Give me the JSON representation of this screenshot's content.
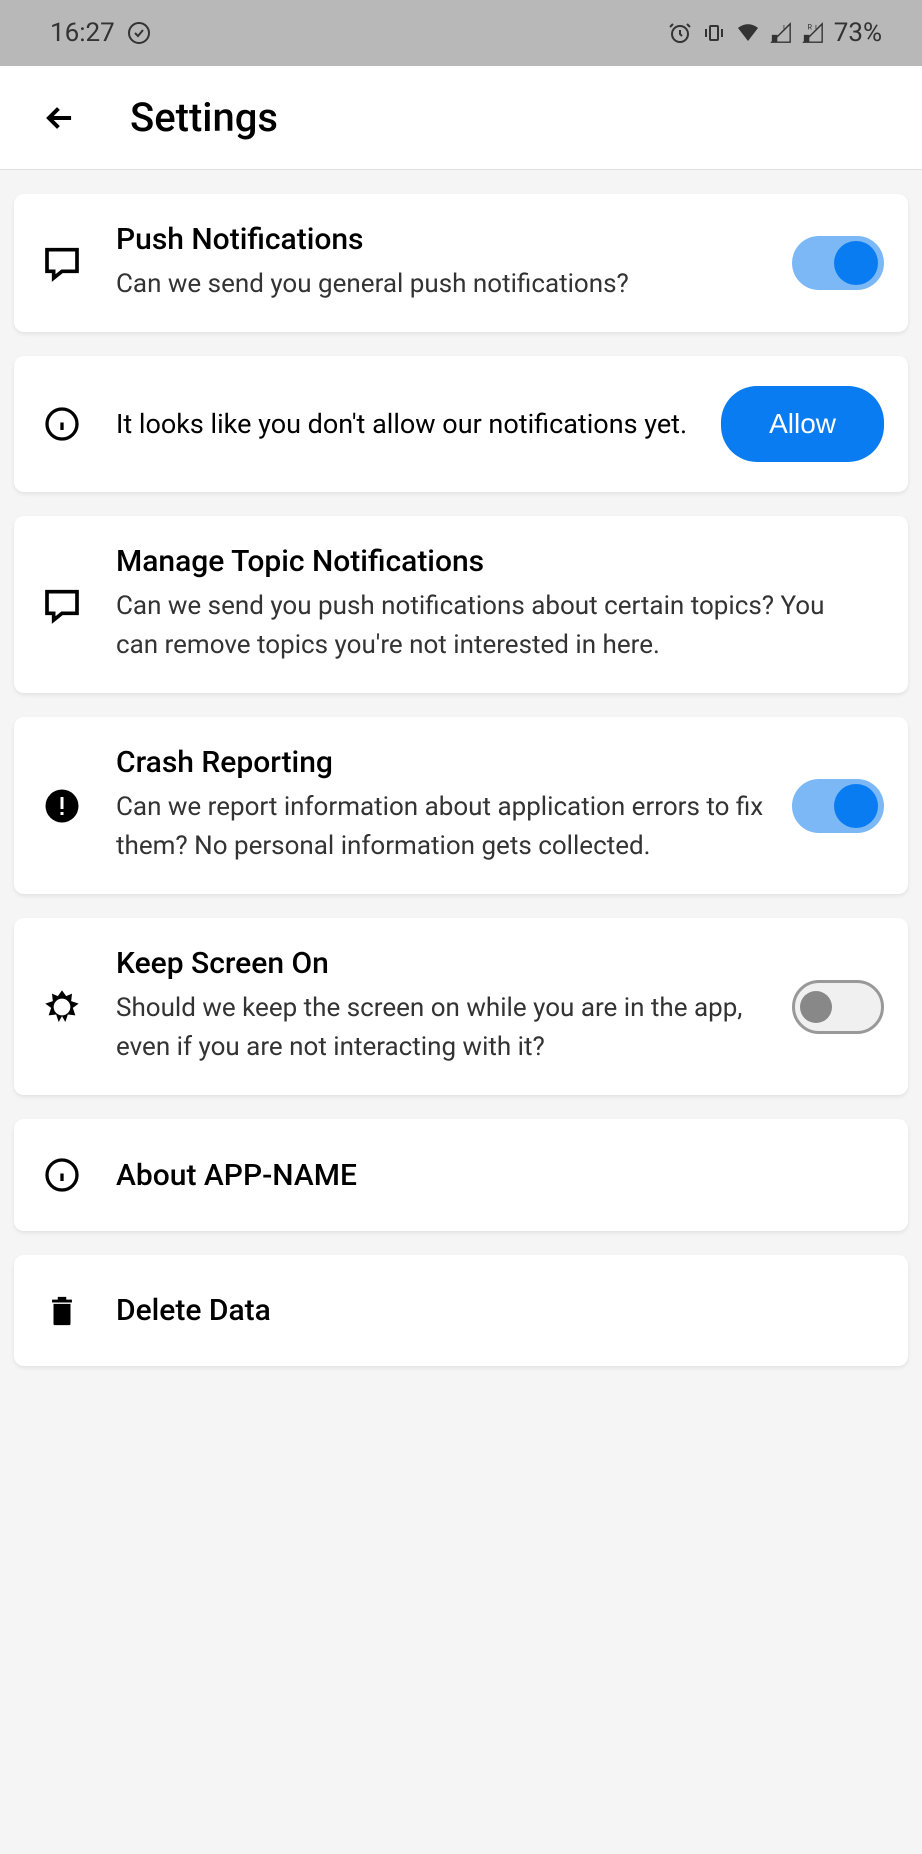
{
  "statusBar": {
    "time": "16:27",
    "battery": "73%"
  },
  "header": {
    "title": "Settings"
  },
  "settings": {
    "pushNotifications": {
      "title": "Push Notifications",
      "description": "Can we send you general push notifications?"
    },
    "notificationWarning": {
      "text": "It looks like you don't allow our notifications yet.",
      "buttonLabel": "Allow"
    },
    "manageTopics": {
      "title": "Manage Topic Notifications",
      "description": "Can we send you push notifications about certain topics? You can remove topics you're not interested in here."
    },
    "crashReporting": {
      "title": "Crash Reporting",
      "description": "Can we report information about application errors to fix them? No personal information gets collected."
    },
    "keepScreenOn": {
      "title": "Keep Screen On",
      "description": "Should we keep the screen on while you are in the app, even if you are not interacting with it?"
    },
    "about": {
      "title": "About APP-NAME"
    },
    "deleteData": {
      "title": "Delete Data"
    }
  }
}
